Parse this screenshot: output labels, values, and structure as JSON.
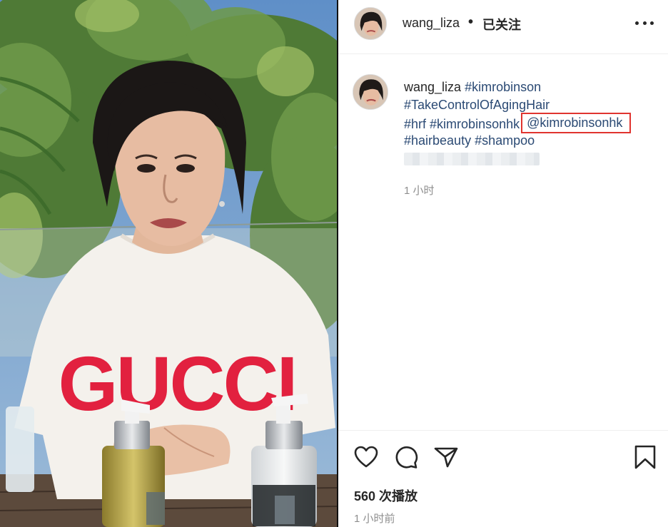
{
  "post": {
    "username": "wang_liza",
    "separator": "•",
    "follow_status": "已关注",
    "caption": {
      "username": "wang_liza",
      "tags_line1": "#kimrobinson",
      "tags_line2": "#TakeControlOfAgingHair",
      "tag_hrf": "#hrf",
      "tag_kimrobinsonhk": "#kimrobinsonhk",
      "mention": "@kimrobinsonhk",
      "tag_hairbeauty": "#hairbeauty",
      "tag_shampoo": "#shampoo"
    },
    "caption_time": "1 小时",
    "views": "560 次播放",
    "posted_time": "1 小时前"
  },
  "media": {
    "shirt_text": "GUCCI"
  },
  "colors": {
    "link": "#2b4a74",
    "highlight_box": "#e0342f",
    "secondary_text": "#8e8e8e"
  },
  "icons": [
    "more-options-icon",
    "heart-icon",
    "comment-icon",
    "share-icon",
    "bookmark-icon"
  ]
}
